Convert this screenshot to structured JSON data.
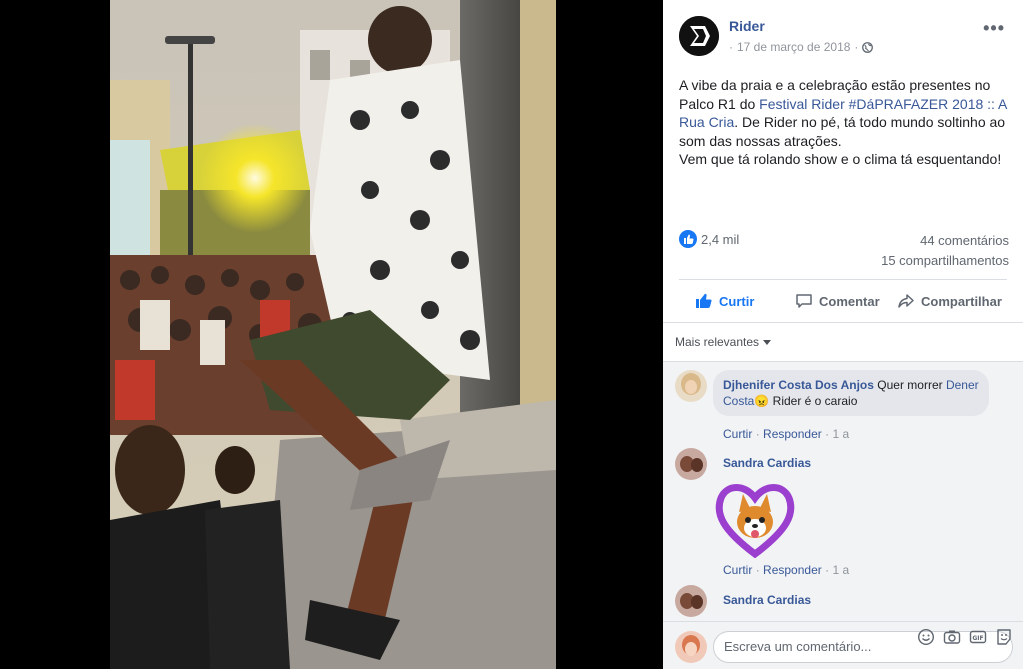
{
  "post": {
    "page_name": "Rider",
    "date": "17 de março de 2018",
    "date_separator": "·",
    "text_part1": "A vibe da praia e a celebração estão presentes no Palco R1 do ",
    "text_link": "Festival Rider #DáPRAFAZER 2018 :: A Rua Cria",
    "text_part2": ". De Rider no pé, tá todo mundo soltinho ao som das nossas atrações.",
    "text_line2": "Vem que tá rolando show e o clima tá esquentando!"
  },
  "stats": {
    "reactions": "2,4 mil",
    "comments": "44 comentários",
    "shares": "15 compartilhamentos"
  },
  "actions": {
    "like": "Curtir",
    "comment": "Comentar",
    "share": "Compartilhar"
  },
  "filter": {
    "label": "Mais relevantes"
  },
  "comments": [
    {
      "author": "Djhenifer Costa Dos Anjos",
      "text_before": "Quer morrer",
      "mention": "Dener Costa",
      "emoji": "😠",
      "text_after": "Rider é o caraio",
      "reply_like": "Curtir",
      "reply_reply": "Responder",
      "sep": "·",
      "age": "1 a"
    },
    {
      "author": "Sandra Cardias",
      "reply_like": "Curtir",
      "reply_reply": "Responder",
      "sep": "·",
      "age": "1 a"
    },
    {
      "author": "Sandra Cardias"
    }
  ],
  "composer": {
    "placeholder": "Escreva um comentário..."
  },
  "colors": {
    "link": "#385898",
    "like_blue": "#1877f2",
    "text": "#1c1e21",
    "muted": "#90949c"
  },
  "icons": [
    "globe-icon",
    "more-icon",
    "like-icon",
    "thumbs-up-icon",
    "comment-icon",
    "share-icon",
    "caret-down-icon",
    "emoji-icon",
    "camera-icon",
    "gif-icon",
    "sticker-icon"
  ]
}
